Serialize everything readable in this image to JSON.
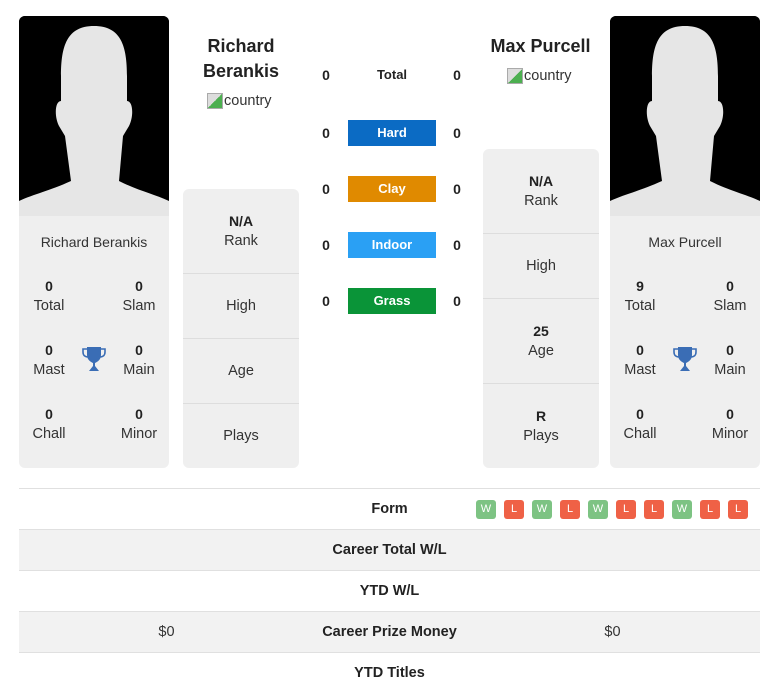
{
  "colors": {
    "hard": "#0b6bc4",
    "clay": "#e08a00",
    "indoor": "#2aa0f4",
    "grass": "#0a9438",
    "win": "#7dc383",
    "loss": "#ef6146",
    "trophy": "#3a6db5"
  },
  "player1": {
    "name_head": "Richard Berankis",
    "flag_alt": "country",
    "card_name": "Richard Berankis",
    "stats": {
      "total": {
        "value": "0",
        "label": "Total"
      },
      "slam": {
        "value": "0",
        "label": "Slam"
      },
      "mast": {
        "value": "0",
        "label": "Mast"
      },
      "main": {
        "value": "0",
        "label": "Main"
      },
      "chall": {
        "value": "0",
        "label": "Chall"
      },
      "minor": {
        "value": "0",
        "label": "Minor"
      }
    },
    "info": {
      "rank": {
        "value": "N/A",
        "label": "Rank"
      },
      "high": {
        "value": "",
        "label": "High"
      },
      "age": {
        "value": "",
        "label": "Age"
      },
      "plays": {
        "value": "",
        "label": "Plays"
      }
    }
  },
  "player2": {
    "name_head": "Max Purcell",
    "flag_alt": "country",
    "card_name": "Max Purcell",
    "stats": {
      "total": {
        "value": "9",
        "label": "Total"
      },
      "slam": {
        "value": "0",
        "label": "Slam"
      },
      "mast": {
        "value": "0",
        "label": "Mast"
      },
      "main": {
        "value": "0",
        "label": "Main"
      },
      "chall": {
        "value": "0",
        "label": "Chall"
      },
      "minor": {
        "value": "0",
        "label": "Minor"
      }
    },
    "info": {
      "rank": {
        "value": "N/A",
        "label": "Rank"
      },
      "high": {
        "value": "",
        "label": "High"
      },
      "age": {
        "value": "25",
        "label": "Age"
      },
      "plays": {
        "value": "R",
        "label": "Plays"
      }
    }
  },
  "h2h": [
    {
      "label": "Total",
      "p1": "0",
      "p2": "0",
      "surface": "total"
    },
    {
      "label": "Hard",
      "p1": "0",
      "p2": "0",
      "surface": "hard"
    },
    {
      "label": "Clay",
      "p1": "0",
      "p2": "0",
      "surface": "clay"
    },
    {
      "label": "Indoor",
      "p1": "0",
      "p2": "0",
      "surface": "indoor"
    },
    {
      "label": "Grass",
      "p1": "0",
      "p2": "0",
      "surface": "grass"
    }
  ],
  "table": {
    "form": {
      "label": "Form",
      "p2_results": [
        "W",
        "L",
        "W",
        "L",
        "W",
        "L",
        "L",
        "W",
        "L",
        "L"
      ]
    },
    "career_wl": {
      "label": "Career Total W/L",
      "p1": "",
      "p2": ""
    },
    "ytd_wl": {
      "label": "YTD W/L",
      "p1": "",
      "p2": ""
    },
    "prize": {
      "label": "Career Prize Money",
      "p1": "$0",
      "p2": "$0"
    },
    "ytd_titles": {
      "label": "YTD Titles",
      "p1": "",
      "p2": ""
    }
  }
}
